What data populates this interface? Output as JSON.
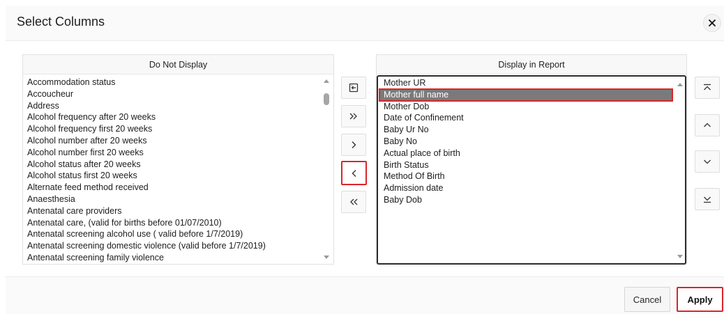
{
  "dialog": {
    "title": "Select Columns",
    "close_icon": "close-icon"
  },
  "left_panel": {
    "header": "Do Not Display",
    "items": [
      "Accommodation status",
      "Accoucheur",
      "Address",
      "Alcohol frequency after 20 weeks",
      "Alcohol frequency first 20 weeks",
      "Alcohol number after 20 weeks",
      "Alcohol number first 20 weeks",
      "Alcohol status after 20 weeks",
      "Alcohol status first 20 weeks",
      "Alternate feed method received",
      "Anaesthesia",
      "Antenatal care providers",
      "Antenatal care, (valid for births before 01/07/2010)",
      "Antenatal screening alcohol use ( valid before 1/7/2019)",
      "Antenatal screening domestic violence (valid before 1/7/2019)",
      "Antenatal screening family violence"
    ]
  },
  "right_panel": {
    "header": "Display in Report",
    "selected_item": "Mother full name",
    "items": [
      "Mother UR",
      "Mother full name",
      "Mother Dob",
      "Date of Confinement",
      "Baby Ur No",
      "Baby No",
      "Actual place of birth",
      "Birth Status",
      "Method Of Birth",
      "Admission date",
      "Baby Dob"
    ]
  },
  "transfer_buttons": [
    {
      "name": "reset-icon",
      "action": "Reset"
    },
    {
      "name": "move-all-right-icon",
      "action": "Move all"
    },
    {
      "name": "move-right-icon",
      "action": "Move"
    },
    {
      "name": "move-left-icon",
      "action": "Remove",
      "highlighted": true
    },
    {
      "name": "move-all-left-icon",
      "action": "Remove all"
    }
  ],
  "order_buttons": [
    {
      "name": "move-top-icon",
      "action": "Top"
    },
    {
      "name": "move-up-icon",
      "action": "Up"
    },
    {
      "name": "move-down-icon",
      "action": "Down"
    },
    {
      "name": "move-bottom-icon",
      "action": "Bottom"
    }
  ],
  "footer": {
    "cancel_label": "Cancel",
    "apply_label": "Apply"
  },
  "colors": {
    "highlight_border": "#d9252c",
    "selected_row": "#7a7a7a",
    "active_list_border": "#2b2b2b"
  }
}
